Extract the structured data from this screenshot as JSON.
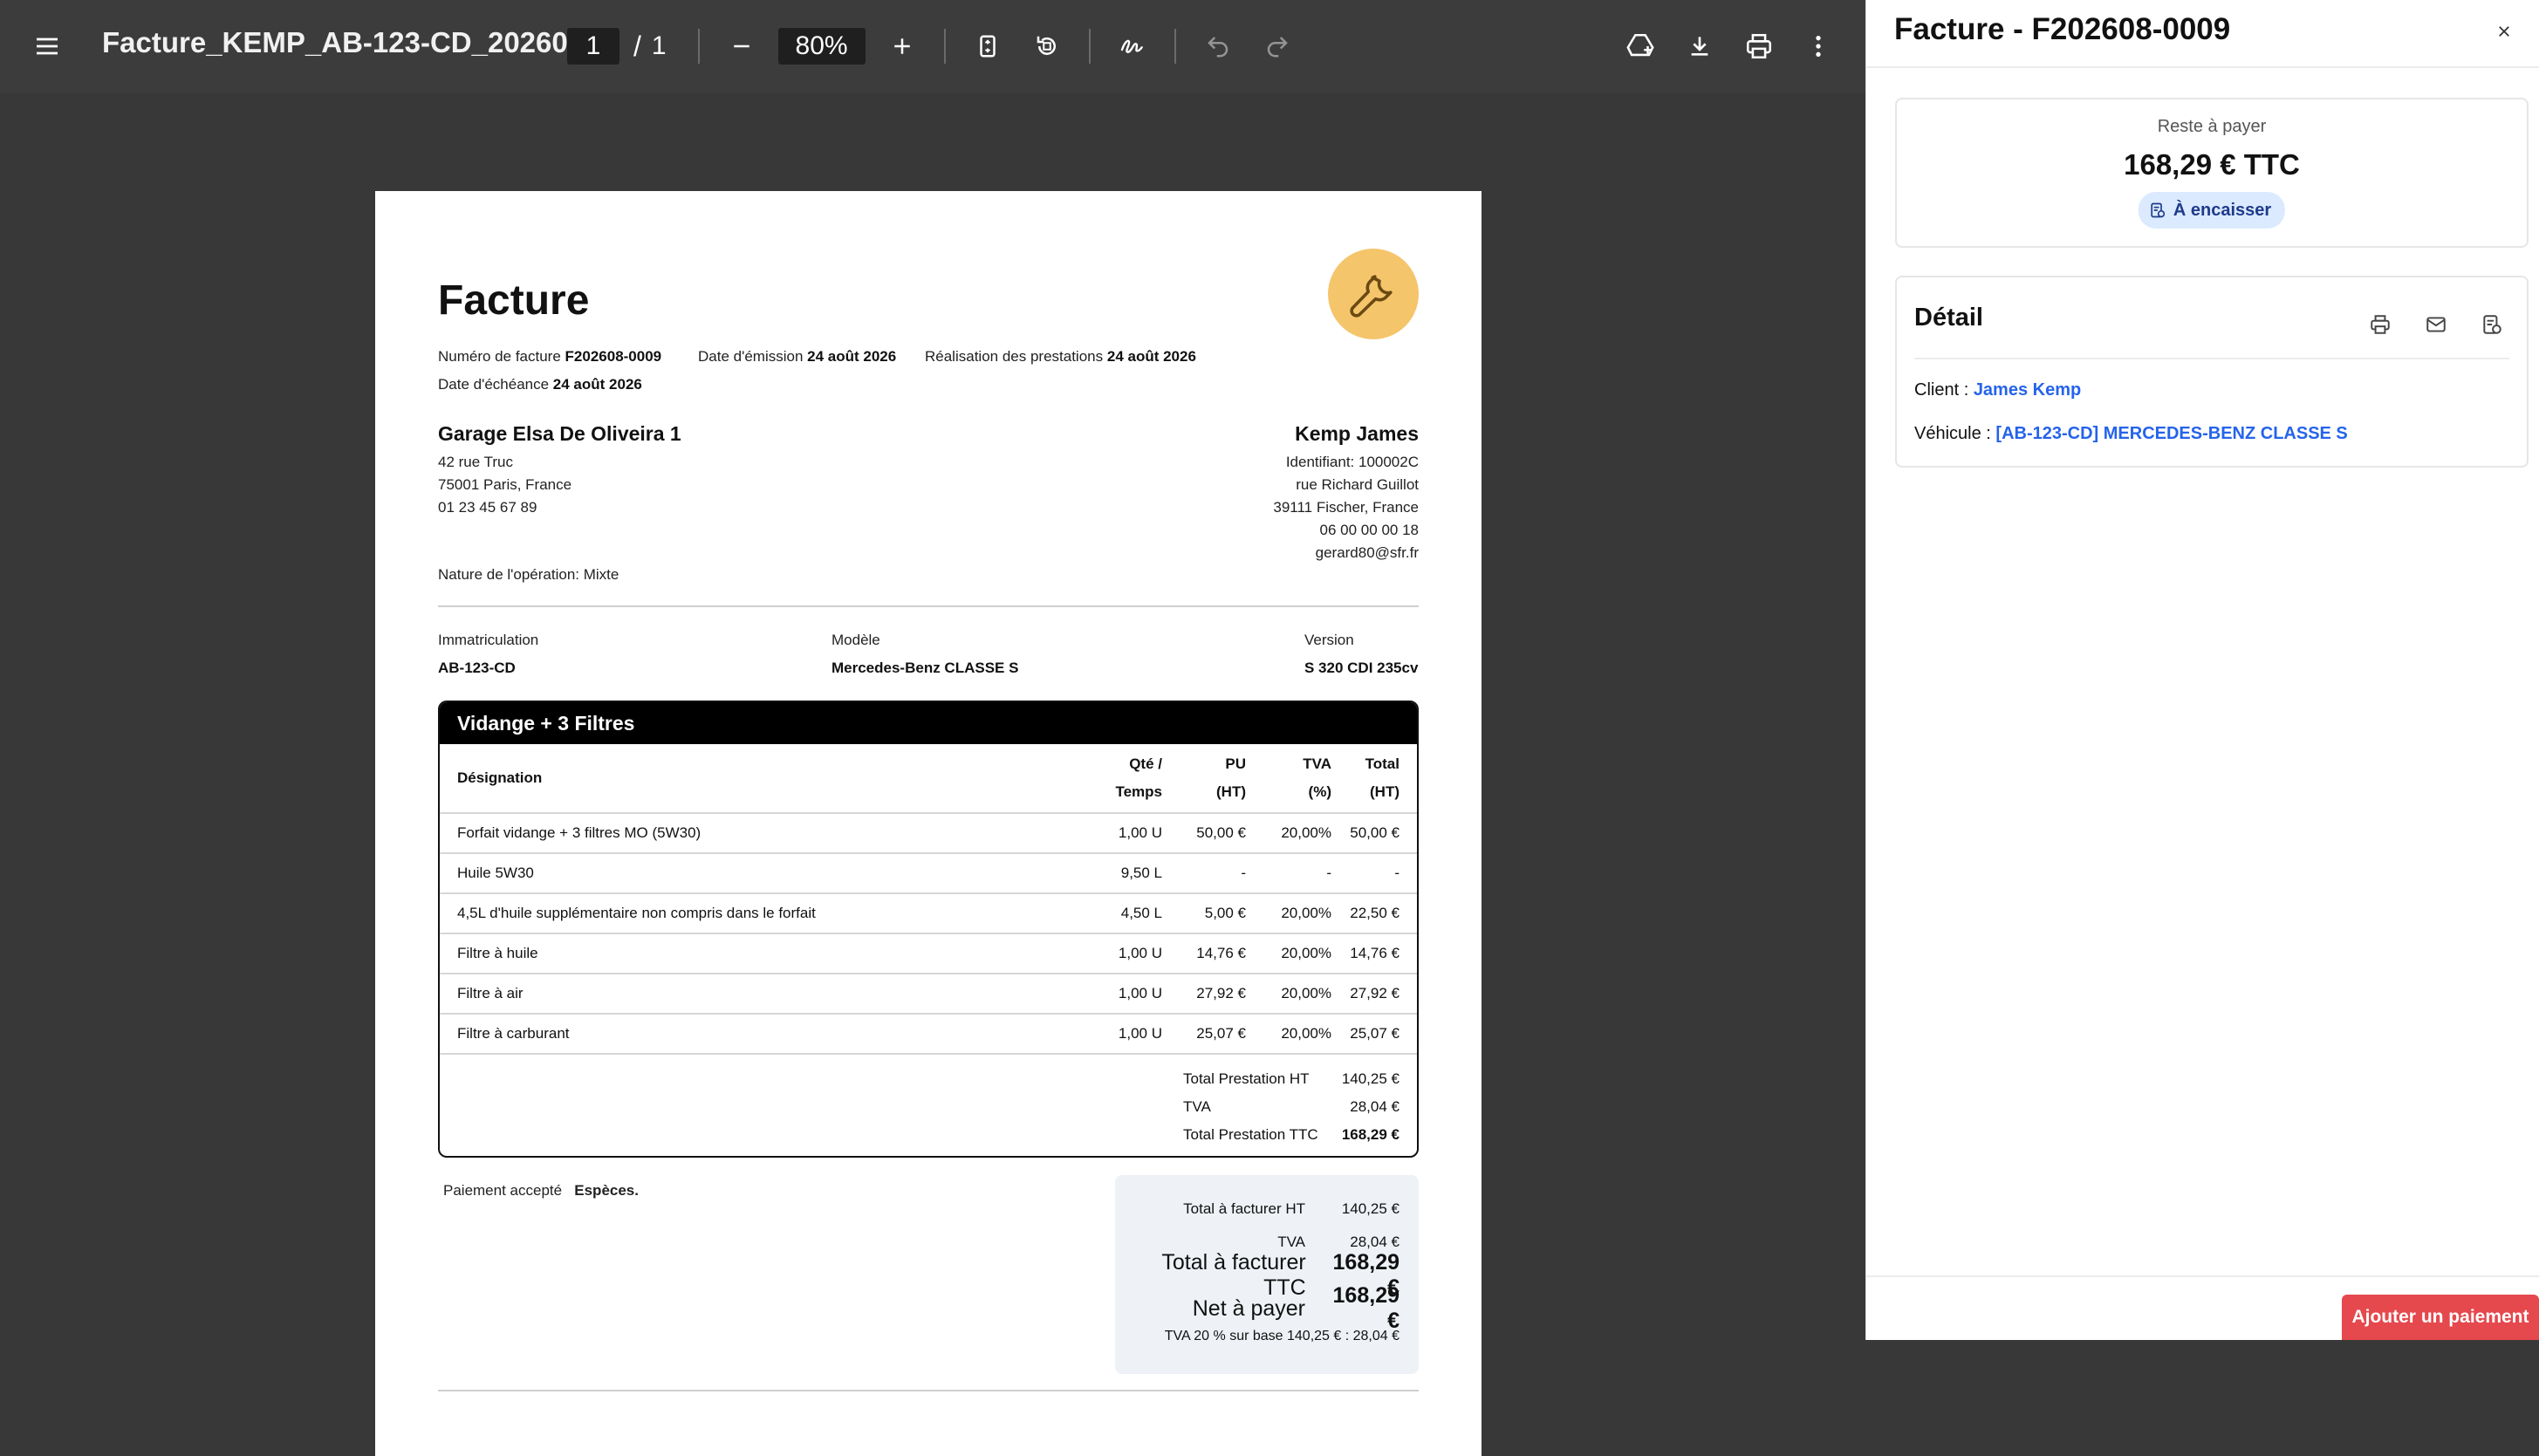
{
  "viewer": {
    "filename": "Facture_KEMP_AB-123-CD_20260...",
    "page_current": "1",
    "page_separator": "/",
    "page_total": "1",
    "zoom": "80%"
  },
  "invoice": {
    "title": "Facture",
    "number_label": "Numéro de facture",
    "number": "F202608-0009",
    "issue_label": "Date d'émission",
    "issue_date": "24 août 2026",
    "service_label": "Réalisation des prestations",
    "service_date": "24 août 2026",
    "due_label": "Date d'échéance",
    "due_date": "24 août 2026",
    "garage": {
      "name": "Garage Elsa De Oliveira 1",
      "lines": [
        "42 rue Truc",
        "75001 Paris, France",
        "01 23 45 67 89"
      ]
    },
    "client": {
      "name": "Kemp James",
      "lines": [
        "Identifiant: 100002C",
        "rue Richard Guillot",
        "39111 Fischer, France",
        "06 00 00 00 18",
        "gerard80@sfr.fr"
      ]
    },
    "operation": "Nature de l'opération: Mixte",
    "vehicle": {
      "plate_label": "Immatriculation",
      "plate": "AB-123-CD",
      "model_label": "Modèle",
      "model": "Mercedes-Benz CLASSE S",
      "version_label": "Version",
      "version": "S 320 CDI 235cv"
    },
    "section": {
      "title": "Vidange + 3 Filtres",
      "headers": {
        "designation": "Désignation",
        "qty_1": "Qté /",
        "qty_2": "Temps",
        "pu_1": "PU",
        "pu_2": "(HT)",
        "tva_1": "TVA",
        "tva_2": "(%)",
        "total_1": "Total",
        "total_2": "(HT)"
      },
      "rows": [
        {
          "designation": "Forfait vidange + 3 filtres MO (5W30)",
          "qty": "1,00 U",
          "pu": "50,00 €",
          "tva": "20,00%",
          "total": "50,00 €"
        },
        {
          "designation": "Huile 5W30",
          "qty": "9,50 L",
          "pu": "-",
          "tva": "-",
          "total": "-"
        },
        {
          "designation": "4,5L d'huile supplémentaire non compris dans le forfait",
          "qty": "4,50 L",
          "pu": "5,00 €",
          "tva": "20,00%",
          "total": "22,50 €"
        },
        {
          "designation": "Filtre à huile",
          "qty": "1,00 U",
          "pu": "14,76 €",
          "tva": "20,00%",
          "total": "14,76 €"
        },
        {
          "designation": "Filtre à air",
          "qty": "1,00 U",
          "pu": "27,92 €",
          "tva": "20,00%",
          "total": "27,92 €"
        },
        {
          "designation": "Filtre à carburant",
          "qty": "1,00 U",
          "pu": "25,07 €",
          "tva": "20,00%",
          "total": "25,07 €"
        }
      ],
      "subtotals": [
        {
          "label": "Total Prestation HT",
          "value": "140,25 €"
        },
        {
          "label": "TVA",
          "value": "28,04 €"
        },
        {
          "label": "Total Prestation TTC",
          "value": "168,29 €"
        }
      ]
    },
    "payment_label": "Paiement accepté",
    "payment_method": "Espèces.",
    "totals": {
      "ht_label": "Total à facturer HT",
      "ht": "140,25 €",
      "tva_label": "TVA",
      "tva": "28,04 €",
      "ttc_label": "Total à facturer TTC",
      "ttc": "168,29 €",
      "net_label": "Net à payer",
      "net": "168,29 €",
      "tva_note": "TVA 20 % sur base 140,25 € : 28,04 €"
    }
  },
  "panel": {
    "title": "Facture - F202608-0009",
    "remaining_label": "Reste à payer",
    "remaining_amount": "168,29 € TTC",
    "status_badge": "À encaisser",
    "detail_title": "Détail",
    "client_label": "Client :",
    "client_name": "James Kemp",
    "vehicle_label": "Véhicule :",
    "vehicle_value": "[AB-123-CD] MERCEDES-BENZ CLASSE S",
    "add_payment": "Ajouter un paiement"
  },
  "colors": {
    "toolbar": "#3c3c3c",
    "viewer_bg": "#383838",
    "logo": "#f5c56b",
    "badge_bg": "#dbeafe",
    "link": "#2563eb",
    "primary_button": "#e5484d"
  },
  "icons": [
    "menu-icon",
    "zoom-out-icon",
    "zoom-in-icon",
    "fit-page-icon",
    "rotate-icon",
    "annotate-icon",
    "undo-icon",
    "redo-icon",
    "drive-add-icon",
    "download-icon",
    "print-icon",
    "more-vert-icon",
    "wrench-icon",
    "close-icon",
    "receipt-icon",
    "mail-icon"
  ]
}
